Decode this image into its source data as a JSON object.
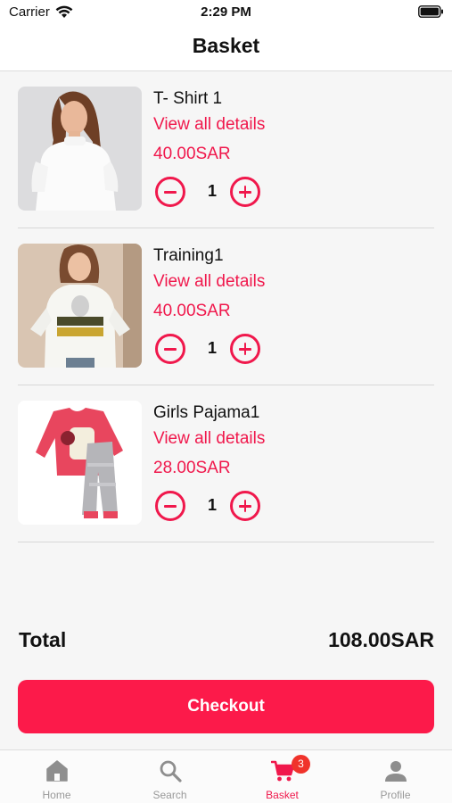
{
  "status_bar": {
    "carrier": "Carrier",
    "time": "2:29 PM"
  },
  "header": {
    "title": "Basket"
  },
  "items": [
    {
      "name": "T- Shirt 1",
      "details_label": "View all details",
      "price": "40.00SAR",
      "quantity": "1",
      "image": "white-tshirt-photo"
    },
    {
      "name": "Training1",
      "details_label": "View all details",
      "price": "40.00SAR",
      "quantity": "1",
      "image": "graphic-tee-photo"
    },
    {
      "name": "Girls Pajama1",
      "details_label": "View all details",
      "price": "28.00SAR",
      "quantity": "1",
      "image": "pink-pajama-photo"
    }
  ],
  "summary": {
    "total_label": "Total",
    "total_value": "108.00SAR"
  },
  "checkout": {
    "label": "Checkout"
  },
  "tabbar": {
    "tabs": [
      {
        "label": "Home",
        "icon": "home-icon"
      },
      {
        "label": "Search",
        "icon": "search-icon"
      },
      {
        "label": "Basket",
        "icon": "cart-icon",
        "badge": "3",
        "active": true
      },
      {
        "label": "Profile",
        "icon": "person-icon"
      }
    ]
  },
  "colors": {
    "accent": "#f0184c",
    "button": "#fc1a4a",
    "badge": "#f0332b",
    "inactive": "#8e8e8e"
  }
}
